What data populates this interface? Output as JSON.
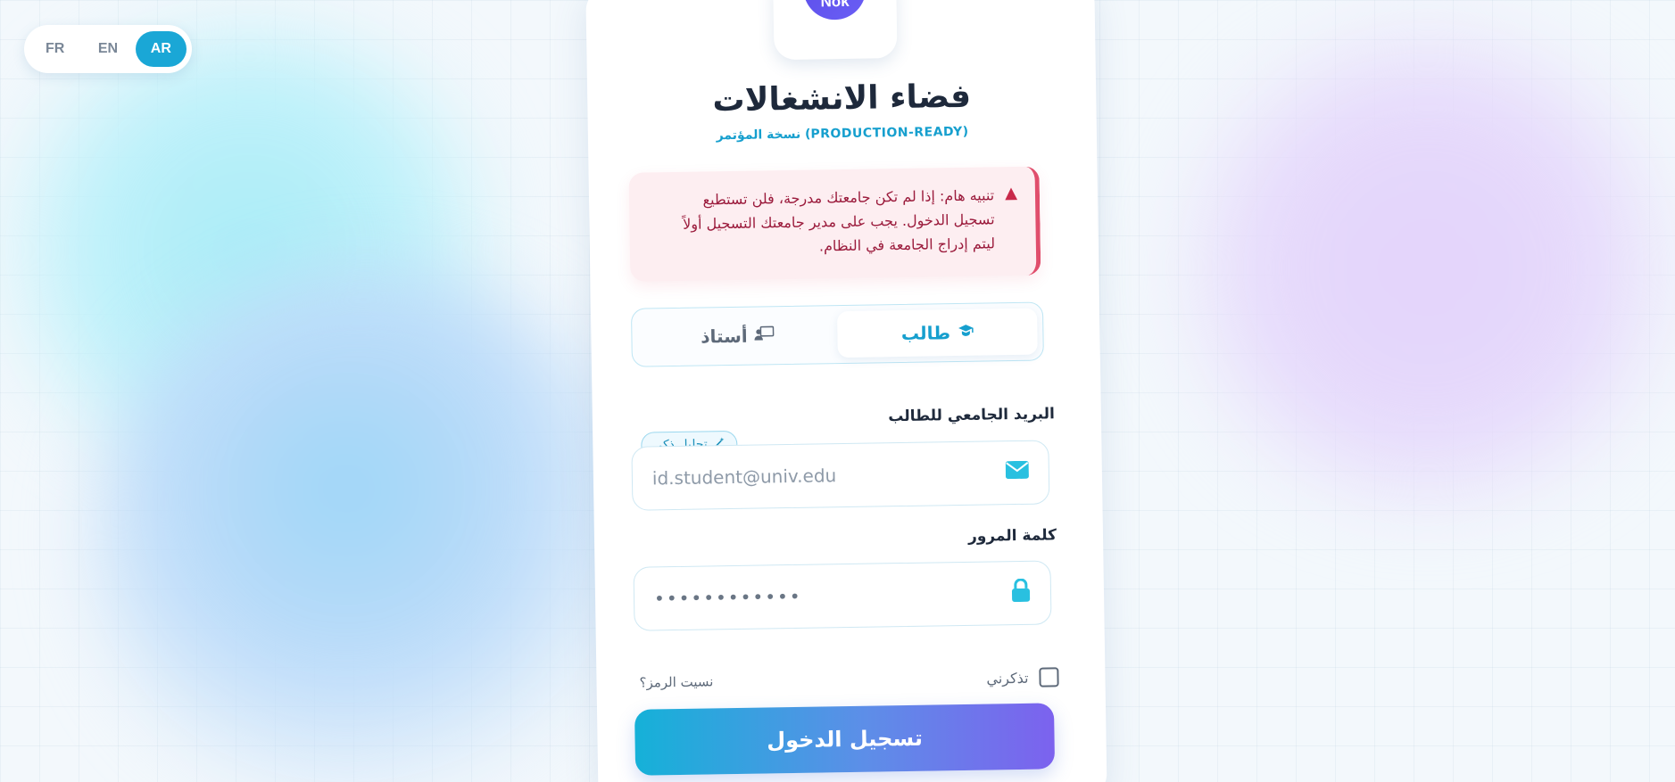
{
  "language_switch": {
    "options": [
      "FR",
      "EN",
      "AR"
    ],
    "active": "AR"
  },
  "logo": {
    "text": "Nok"
  },
  "header": {
    "title": "فضاء الانشغالات",
    "subtitle": "نسخة المؤتمر (PRODUCTION-READY)"
  },
  "alert": {
    "icon": "warning-icon",
    "text": "تنبيه هام: إذا لم تكن جامعتك مدرجة، فلن تستطيع تسجيل الدخول. يجب على مدير جامعتك التسجيل أولاً ليتم إدراج الجامعة في النظام."
  },
  "tabs": [
    {
      "label": "طالب",
      "icon": "graduate-icon",
      "active": true
    },
    {
      "label": "أستاذ",
      "icon": "teacher-icon",
      "active": false
    }
  ],
  "email": {
    "label": "البريد الجامعي للطالب",
    "badge": "تحليل ذكي",
    "placeholder": "id.student@univ.edu",
    "icon": "envelope-icon"
  },
  "password": {
    "label": "كلمة المرور",
    "value": "••••••••••••",
    "icon": "lock-icon"
  },
  "remember_label": "تذكرني",
  "forgot_label": "نسيت الرمز؟",
  "submit_label": "تسجيل الدخول",
  "colors": {
    "accent": "#1aa7d6",
    "alert_bg": "#fdeef1",
    "alert_text": "#9b1b3c",
    "button_gradient_start": "#15b1d8",
    "button_gradient_end": "#7c62ee"
  }
}
